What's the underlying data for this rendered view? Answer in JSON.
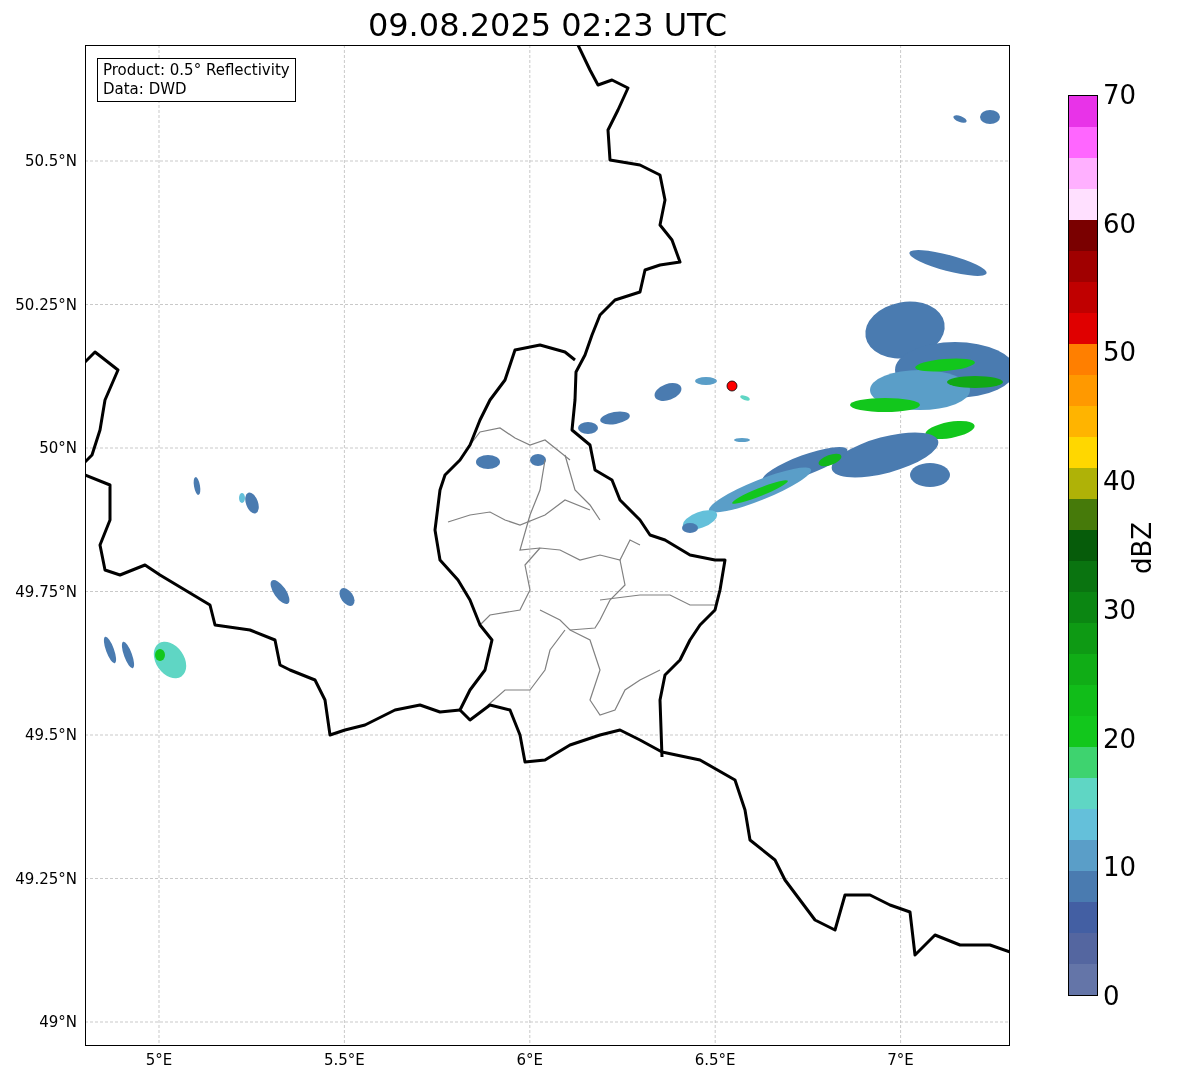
{
  "title": "09.08.2025 02:23 UTC",
  "info_box": {
    "lines": [
      "Product: 0.5° Reflectivity",
      "Data: DWD"
    ]
  },
  "y_ticks": [
    "50.5°N",
    "50.25°N",
    "50°N",
    "49.75°N",
    "49.5°N",
    "49.25°N",
    "49°N"
  ],
  "x_ticks": [
    "5°E",
    "5.5°E",
    "6°E",
    "6.5°E",
    "7°E"
  ],
  "colorbar": {
    "label": "dBZ",
    "ticks": [
      "70",
      "60",
      "50",
      "40",
      "30",
      "20",
      "10",
      "0"
    ],
    "segments": [
      {
        "color": "#e833e8"
      },
      {
        "color": "#ff66ff"
      },
      {
        "color": "#ffb0ff"
      },
      {
        "color": "#ffe0ff"
      },
      {
        "color": "#7a0000"
      },
      {
        "color": "#a00000"
      },
      {
        "color": "#c00000"
      },
      {
        "color": "#e00000"
      },
      {
        "color": "#ff7f00"
      },
      {
        "color": "#ff9900"
      },
      {
        "color": "#ffb400"
      },
      {
        "color": "#ffd700"
      },
      {
        "color": "#afb207"
      },
      {
        "color": "#467a0a"
      },
      {
        "color": "#065c0a"
      },
      {
        "color": "#0a7410"
      },
      {
        "color": "#0b8612"
      },
      {
        "color": "#0e9a14"
      },
      {
        "color": "#10ad16"
      },
      {
        "color": "#11bd19"
      },
      {
        "color": "#12c71c"
      },
      {
        "color": "#3ed36f"
      },
      {
        "color": "#5fd6c4"
      },
      {
        "color": "#64c0da"
      },
      {
        "color": "#5a9ec8"
      },
      {
        "color": "#4a7bb0"
      },
      {
        "color": "#435fa3"
      },
      {
        "color": "#5466a0"
      },
      {
        "color": "#6475a8"
      }
    ]
  }
}
